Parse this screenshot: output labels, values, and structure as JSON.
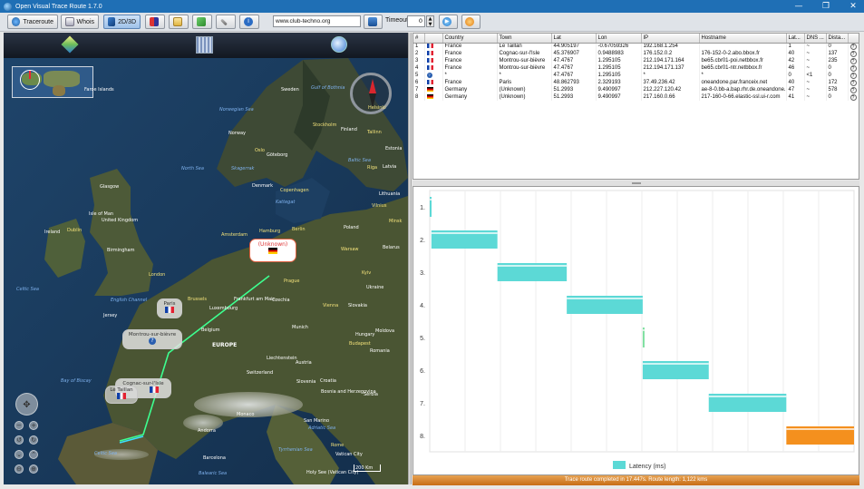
{
  "window": {
    "title": "Open Visual Trace Route 1.7.0",
    "minimize": "—",
    "maximize": "❐",
    "close": "✕"
  },
  "toolbar": {
    "traceroute_label": "Traceroute",
    "whois_label": "Whois",
    "view_label": "2D/3D",
    "url_value": "www.club-techno.org",
    "timeout_label": "Timeout",
    "timeout_value": "0"
  },
  "table": {
    "columns": [
      "#",
      "",
      "Country",
      "Town",
      "Lat",
      "Lon",
      "IP",
      "Hostname",
      "Lat...",
      "DNS ...",
      "Dista...",
      ""
    ],
    "rows": [
      {
        "num": "1",
        "flag": "fr",
        "country": "France",
        "town": "Le Taillan",
        "lat": "44.905197",
        "lon": "-0.67059326",
        "ip": "192.168.1.254",
        "host": "",
        "latency": "1",
        "dns": "~",
        "dist": "0"
      },
      {
        "num": "2",
        "flag": "fr",
        "country": "France",
        "town": "Cognac-sur-l'Isle",
        "lat": "45.376907",
        "lon": "0.9488983",
        "ip": "176.152.0.2",
        "host": "176-152-0-2.abo.bbox.fr",
        "latency": "40",
        "dns": "~",
        "dist": "137"
      },
      {
        "num": "3",
        "flag": "fr",
        "country": "France",
        "town": "Montrou-sur-bièvre",
        "lat": "47.4767",
        "lon": "1.295105",
        "ip": "212.194.171.164",
        "host": "be65.cbr01-poi.netbbox.fr",
        "latency": "42",
        "dns": "~",
        "dist": "235"
      },
      {
        "num": "4",
        "flag": "fr",
        "country": "France",
        "town": "Montrou-sur-bièvre",
        "lat": "47.4767",
        "lon": "1.295105",
        "ip": "212.194.171.137",
        "host": "be65.cbr01-ntr.netbbox.fr",
        "latency": "46",
        "dns": "~",
        "dist": "0"
      },
      {
        "num": "5",
        "flag": "unk",
        "country": "*",
        "town": "*",
        "lat": "47.4767",
        "lon": "1.295105",
        "ip": "*",
        "host": "*",
        "latency": "0",
        "dns": "<1",
        "dist": "0"
      },
      {
        "num": "6",
        "flag": "fr",
        "country": "France",
        "town": "Paris",
        "lat": "48.862793",
        "lon": "2.329193",
        "ip": "37.49.236.42",
        "host": "oneandone.par.franceix.net",
        "latency": "40",
        "dns": "~",
        "dist": "172"
      },
      {
        "num": "7",
        "flag": "de",
        "country": "Germany",
        "town": "(Unknown)",
        "lat": "51.2993",
        "lon": "9.490997",
        "ip": "212.227.120.42",
        "host": "ae-8-0.bb-a.bap.rhr.de.oneandone.net",
        "latency": "47",
        "dns": "~",
        "dist": "578"
      },
      {
        "num": "8",
        "flag": "de",
        "country": "Germany",
        "town": "(Unknown)",
        "lat": "51.2993",
        "lon": "9.490997",
        "ip": "217.160.0.66",
        "host": "217-160-0-66.elastic-ssl.ui-r.com",
        "latency": "41",
        "dns": "~",
        "dist": "0"
      }
    ]
  },
  "chart_data": {
    "type": "bar",
    "categories": [
      "1.",
      "2.",
      "3.",
      "4.",
      "5.",
      "6.",
      "7.",
      "8."
    ],
    "series": [
      {
        "name": "Latency (ms)",
        "start": [
          0,
          1,
          41,
          83,
          129,
          129,
          169,
          216
        ],
        "values": [
          1,
          40,
          42,
          46,
          1,
          40,
          47,
          41
        ]
      }
    ],
    "xlim": [
      0,
      257
    ],
    "colors": [
      "#5cd9d6",
      "#5cd9d6",
      "#5cd9d6",
      "#5cd9d6",
      "#7ee0a0",
      "#5cd9d6",
      "#5cd9d6",
      "#f4901e"
    ],
    "legend": "Latency (ms)"
  },
  "status": "Trace route completed in 17.447s. Route length: 1,122 kms",
  "map": {
    "labels": [
      {
        "t": "Faroe Islands",
        "c": "w"
      },
      {
        "t": "Norwegian Sea",
        "c": "b"
      },
      {
        "t": "Sweden",
        "c": "w"
      },
      {
        "t": "Gulf of Bothnia",
        "c": "b"
      },
      {
        "t": "Norway",
        "c": "w"
      },
      {
        "t": "Finland",
        "c": "w"
      },
      {
        "t": "Helsinki",
        "c": "y"
      },
      {
        "t": "Oslo",
        "c": "y"
      },
      {
        "t": "Stockholm",
        "c": "y"
      },
      {
        "t": "Tallinn",
        "c": "y"
      },
      {
        "t": "Estonia",
        "c": "w"
      },
      {
        "t": "Riga",
        "c": "y"
      },
      {
        "t": "Latvia",
        "c": "w"
      },
      {
        "t": "Göteborg",
        "c": "w"
      },
      {
        "t": "North Sea",
        "c": "b"
      },
      {
        "t": "Skagerrak",
        "c": "b"
      },
      {
        "t": "Baltic Sea",
        "c": "b"
      },
      {
        "t": "Lithuania",
        "c": "w"
      },
      {
        "t": "Denmark",
        "c": "w"
      },
      {
        "t": "Copenhagen",
        "c": "y"
      },
      {
        "t": "Kattegat",
        "c": "b"
      },
      {
        "t": "Vilnius",
        "c": "y"
      },
      {
        "t": "Minsk",
        "c": "y"
      },
      {
        "t": "Glasgow",
        "c": "w"
      },
      {
        "t": "Isle of Man",
        "c": "w"
      },
      {
        "t": "United Kingdom",
        "c": "w"
      },
      {
        "t": "Ireland",
        "c": "w"
      },
      {
        "t": "Dublin",
        "c": "y"
      },
      {
        "t": "Birmingham",
        "c": "w"
      },
      {
        "t": "London",
        "c": "y"
      },
      {
        "t": "Amsterdam",
        "c": "y"
      },
      {
        "t": "Hamburg",
        "c": "y"
      },
      {
        "t": "Berlin",
        "c": "y"
      },
      {
        "t": "Poland",
        "c": "w"
      },
      {
        "t": "Warsaw",
        "c": "y"
      },
      {
        "t": "Belarus",
        "c": "w"
      },
      {
        "t": "Celtic Sea",
        "c": "b"
      },
      {
        "t": "English Channel",
        "c": "b"
      },
      {
        "t": "Jersey",
        "c": "w"
      },
      {
        "t": "Brussels",
        "c": "y"
      },
      {
        "t": "Frankfurt am Main",
        "c": "w"
      },
      {
        "t": "Luxembourg",
        "c": "w"
      },
      {
        "t": "Prague",
        "c": "y"
      },
      {
        "t": "Czechia",
        "c": "w"
      },
      {
        "t": "Munich",
        "c": "w"
      },
      {
        "t": "Vienna",
        "c": "y"
      },
      {
        "t": "Slovakia",
        "c": "w"
      },
      {
        "t": "Hungary",
        "c": "w"
      },
      {
        "t": "Budapest",
        "c": "y"
      },
      {
        "t": "EUROPE",
        "c": "wb"
      },
      {
        "t": "Switzerland",
        "c": "w"
      },
      {
        "t": "Liechtenstein",
        "c": "w"
      },
      {
        "t": "Austria",
        "c": "w"
      },
      {
        "t": "Slovenia",
        "c": "w"
      },
      {
        "t": "Croatia",
        "c": "w"
      },
      {
        "t": "Bosnia and Herzegovina",
        "c": "w"
      },
      {
        "t": "Serbia",
        "c": "w"
      },
      {
        "t": "Bay of Biscay",
        "c": "b"
      },
      {
        "t": "Monaco",
        "c": "w"
      },
      {
        "t": "San Marino",
        "c": "w"
      },
      {
        "t": "Rome",
        "c": "y"
      },
      {
        "t": "Andorra",
        "c": "w"
      },
      {
        "t": "Barcelona",
        "c": "w"
      },
      {
        "t": "Adriatic Sea",
        "c": "b"
      },
      {
        "t": "Tyrrhenian Sea",
        "c": "b"
      },
      {
        "t": "Balearic Sea",
        "c": "b"
      },
      {
        "t": "Celtic Sea",
        "c": "b"
      },
      {
        "t": "Vatican City",
        "c": "w"
      },
      {
        "t": "Ukraine",
        "c": "w"
      },
      {
        "t": "Moldova",
        "c": "w"
      },
      {
        "t": "Romania",
        "c": "w"
      },
      {
        "t": "Kyiv",
        "c": "y"
      },
      {
        "t": "Belgium",
        "c": "w"
      }
    ],
    "markers": [
      {
        "label": "(Unknown)",
        "flag": "de"
      },
      {
        "label": "Paris",
        "flag": "fr"
      },
      {
        "label": "Montrou-sur-bièvre",
        "flag": "unk"
      },
      {
        "label": "Cognac-sur-l'Isle",
        "flag": "fr2"
      },
      {
        "label": "Le Taillan",
        "flag": "fr"
      }
    ],
    "scale": "200 Km",
    "copyright": "Holy See (Vatican City)"
  }
}
